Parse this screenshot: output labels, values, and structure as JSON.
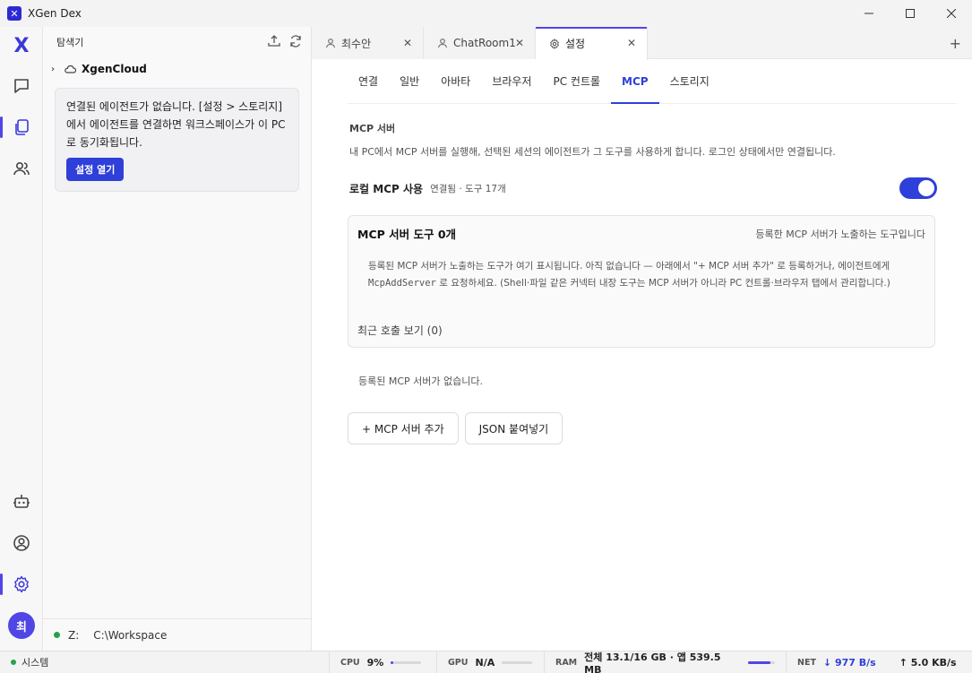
{
  "window": {
    "title": "XGen Dex",
    "minimize": "—",
    "maximize": "☐",
    "close": "✕"
  },
  "rail": {
    "logo": "X",
    "avatar_initial": "최",
    "icons": [
      "chat-icon",
      "copy-icon",
      "users-icon",
      "robot-icon",
      "account-icon",
      "gear-icon"
    ]
  },
  "explorer": {
    "title": "탐색기",
    "tree": [
      {
        "label": "XgenCloud"
      }
    ],
    "notice": {
      "text": "연결된 에이전트가 없습니다. [설정 > 스토리지]에서 에이전트를 연결하면 워크스페이스가 이 PC 로 동기화됩니다.",
      "button": "설정 열기"
    },
    "footer": {
      "drive": "Z:",
      "path": "C:\\Workspace"
    }
  },
  "tabs": [
    {
      "label": "최수안",
      "icon": "person-icon"
    },
    {
      "label": "ChatRoom1",
      "icon": "person-icon"
    },
    {
      "label": "설정",
      "icon": "gear-icon",
      "active": true
    }
  ],
  "tab_add": "+",
  "subtabs": [
    {
      "label": "연결"
    },
    {
      "label": "일반"
    },
    {
      "label": "아바타"
    },
    {
      "label": "브라우저"
    },
    {
      "label": "PC 컨트롤"
    },
    {
      "label": "MCP",
      "active": true
    },
    {
      "label": "스토리지"
    }
  ],
  "mcp": {
    "section_title": "MCP 서버",
    "description": "내 PC에서 MCP 서버를 실행해, 선택된 세션의 에이전트가 그 도구를 사용하게 합니다. 로그인 상태에서만 연결됩니다.",
    "toggle_label": "로컬 MCP 사용",
    "toggle_status": "연결됨 · 도구 17개",
    "toggle_on": true,
    "card": {
      "title": "MCP 서버 도구 0개",
      "subtitle": "등록한 MCP 서버가 노출하는 도구입니다",
      "body_1": "등록된 MCP 서버가 노출하는 도구가 여기 표시됩니다. 아직 없습니다 — 아래에서 \"+ MCP 서버 추가\" 로 등록하거나, 에이전트에게 ",
      "body_code": "McpAddServer",
      "body_2": " 로 요청하세요. (Shell·파일 같은 커넥터 내장 도구는 MCP 서버가 아니라 PC 컨트롤·브라우저 탭에서 관리합니다.)",
      "recent_link": "최근 호출 보기 (0)"
    },
    "empty_message": "등록된 MCP 서버가 없습니다.",
    "add_button": "+ MCP 서버 추가",
    "paste_button": "JSON 붙여넣기"
  },
  "statusbar": {
    "system": "시스템",
    "cpu_label": "CPU",
    "cpu_value": "9%",
    "cpu_fraction": 0.09,
    "gpu_label": "GPU",
    "gpu_value": "N/A",
    "gpu_fraction": 0,
    "ram_label": "RAM",
    "ram_value": "전체 13.1/16 GB · 앱 539.5 MB",
    "ram_fraction": 0.82,
    "net_label": "NET",
    "net_down": "↓ 977 B/s",
    "net_up": "↑ 5.0 KB/s"
  },
  "colors": {
    "accent": "#2f3fd9",
    "status_green": "#22a34a"
  }
}
